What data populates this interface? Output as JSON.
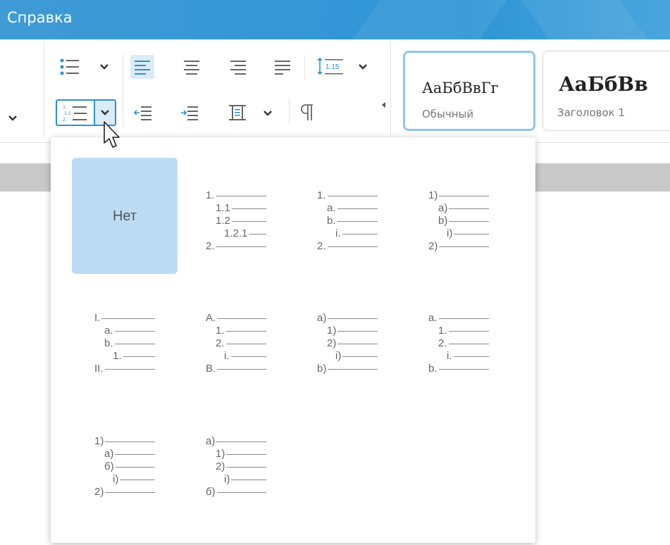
{
  "menubar": {
    "title": "Справка"
  },
  "toolbar": {
    "icons": [
      "bulleted-list-icon",
      "align-left-icon",
      "align-center-icon",
      "align-right-icon",
      "align-justify-icon",
      "line-spacing-icon",
      "numbered-list-icon",
      "decrease-indent-icon",
      "increase-indent-icon",
      "paragraph-spacing-icon",
      "pilcrow-icon"
    ],
    "line_spacing_label": "1.15",
    "numbered_list_glyph": {
      "top": "1.",
      "mid": "1.1",
      "bottom": "2."
    }
  },
  "styles": [
    {
      "sample": "АаБбВвГг",
      "name": "Обычный",
      "selected": true
    },
    {
      "sample": "АаБбВв",
      "name": "Заголовок 1",
      "selected": false
    }
  ],
  "numbering_panel": {
    "none_label": "Нет",
    "presets": [
      [
        [
          "1.",
          0
        ],
        [
          "1.1",
          1
        ],
        [
          "1.2",
          1
        ],
        [
          "1.2.1",
          2
        ],
        [
          "2.",
          0
        ]
      ],
      [
        [
          "1.",
          0
        ],
        [
          "a.",
          1
        ],
        [
          "b.",
          1
        ],
        [
          "i.",
          2
        ],
        [
          "2.",
          0
        ]
      ],
      [
        [
          "1)",
          0
        ],
        [
          "a)",
          1
        ],
        [
          "b)",
          1
        ],
        [
          "i)",
          2
        ],
        [
          "2)",
          0
        ]
      ],
      [
        [
          "I.",
          0
        ],
        [
          "a.",
          1
        ],
        [
          "b.",
          1
        ],
        [
          "1.",
          2
        ],
        [
          "II.",
          0
        ]
      ],
      [
        [
          "A.",
          0
        ],
        [
          "1.",
          1
        ],
        [
          "2.",
          1
        ],
        [
          "i.",
          2
        ],
        [
          "B.",
          0
        ]
      ],
      [
        [
          "a)",
          0
        ],
        [
          "1)",
          1
        ],
        [
          "2)",
          1
        ],
        [
          "i)",
          2
        ],
        [
          "b)",
          0
        ]
      ],
      [
        [
          "a.",
          0
        ],
        [
          "1.",
          1
        ],
        [
          "2.",
          1
        ],
        [
          "i.",
          2
        ],
        [
          "b.",
          0
        ]
      ],
      [
        [
          "1)",
          0
        ],
        [
          "а)",
          1
        ],
        [
          "б)",
          1
        ],
        [
          "i)",
          2
        ],
        [
          "2)",
          0
        ]
      ],
      [
        [
          "а)",
          0
        ],
        [
          "1)",
          1
        ],
        [
          "2)",
          1
        ],
        [
          "i)",
          2
        ],
        [
          "б)",
          0
        ]
      ]
    ]
  },
  "colors": {
    "accent": "#2d8fd5",
    "menubar": "#3199d8",
    "selection": "#bcdcf4"
  }
}
